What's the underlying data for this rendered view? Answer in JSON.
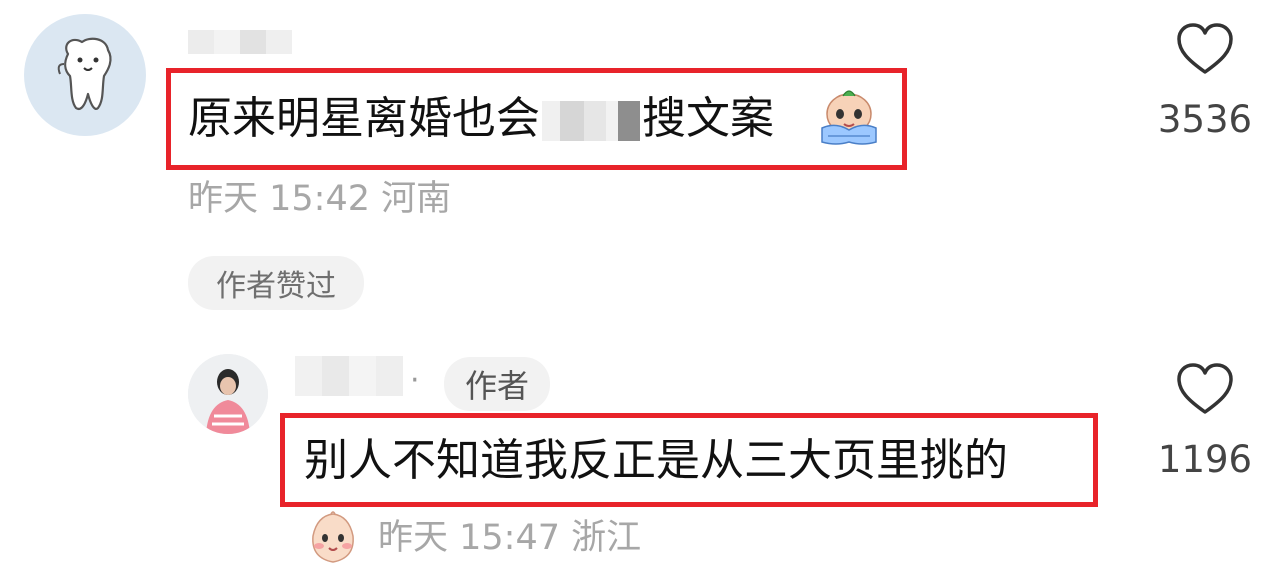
{
  "comments": [
    {
      "text_before": "原来明星离婚也会",
      "text_after": "搜文案",
      "meta": "昨天 15:42 河南",
      "badge": "作者赞过",
      "like_count": "3536",
      "emoji_icon": "crying-face-emoji-icon"
    },
    {
      "author_tag": "作者",
      "separator": "·",
      "text": "别人不知道我反正是从三大页里挑的",
      "meta": "昨天 15:47 浙江",
      "like_count": "1196",
      "emoji_icon": "blushing-face-emoji-icon"
    }
  ],
  "colors": {
    "highlight": "#e8232a",
    "meta_text": "#a7a7a7",
    "avatar1_bg": "#dbe7f2"
  }
}
